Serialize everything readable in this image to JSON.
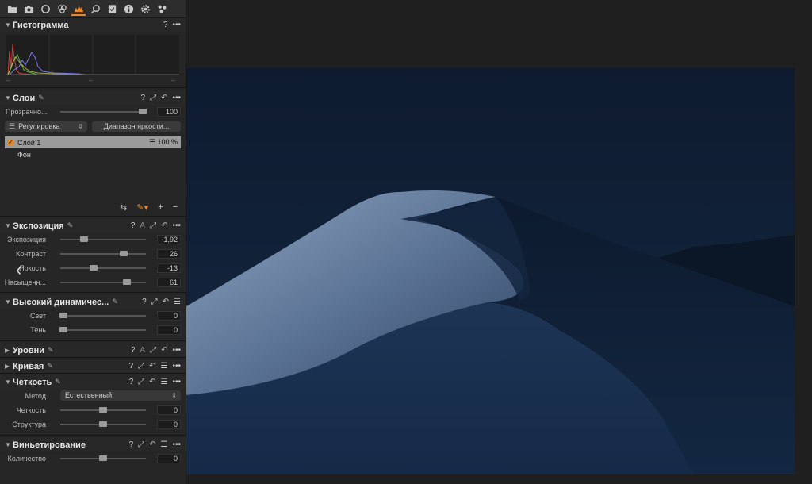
{
  "toolbar": {
    "tools": [
      "folder-icon",
      "camera-icon",
      "circle-icon",
      "color-icon",
      "exposure-icon",
      "search-icon",
      "checklist-icon",
      "info-icon",
      "gear-icon",
      "adjust-icon"
    ],
    "active_index": 4
  },
  "histogram": {
    "title": "Гистограмма",
    "help": "?",
    "more": "•••",
    "labels": [
      "--",
      "--",
      "--"
    ]
  },
  "layers": {
    "title": "Слои",
    "opacity_label": "Прозрачно...",
    "opacity_value": "100",
    "opacity_level": 1.0,
    "adjust_button": "Регулировка",
    "luma_button": "Диапазон яркости...",
    "layer1_name": "Слой 1",
    "layer1_value": "100 %",
    "bg_name": "Фон"
  },
  "exposure": {
    "title": "Экспозиция",
    "auto": "A",
    "rows": [
      {
        "label": "Экспозиция",
        "value": "-1,92",
        "level": 0.28
      },
      {
        "label": "Контраст",
        "value": "26",
        "level": 0.74
      },
      {
        "label": "Яркость",
        "value": "-13",
        "level": 0.39
      },
      {
        "label": "Насыщенн...",
        "value": "61",
        "level": 0.78
      }
    ]
  },
  "hdr": {
    "title": "Высокий динамичес...",
    "rows": [
      {
        "label": "Свет",
        "value": "0",
        "level": 0.04
      },
      {
        "label": "Тень",
        "value": "0",
        "level": 0.04
      }
    ]
  },
  "levels": {
    "title": "Уровни",
    "auto": "A"
  },
  "curve": {
    "title": "Кривая"
  },
  "clarity": {
    "title": "Четкость",
    "method_label": "Метод",
    "method_value": "Естественный",
    "rows": [
      {
        "label": "Четкость",
        "value": "0",
        "level": 0.5
      },
      {
        "label": "Структура",
        "value": "0",
        "level": 0.5
      }
    ]
  },
  "vignette": {
    "title": "Виньетирование",
    "rows": [
      {
        "label": "Количество",
        "value": "0",
        "level": 0.5
      }
    ]
  },
  "colors": {
    "accent": "#e6892b",
    "panel_bg": "#262626",
    "photo_bg": "#0f1d33"
  }
}
